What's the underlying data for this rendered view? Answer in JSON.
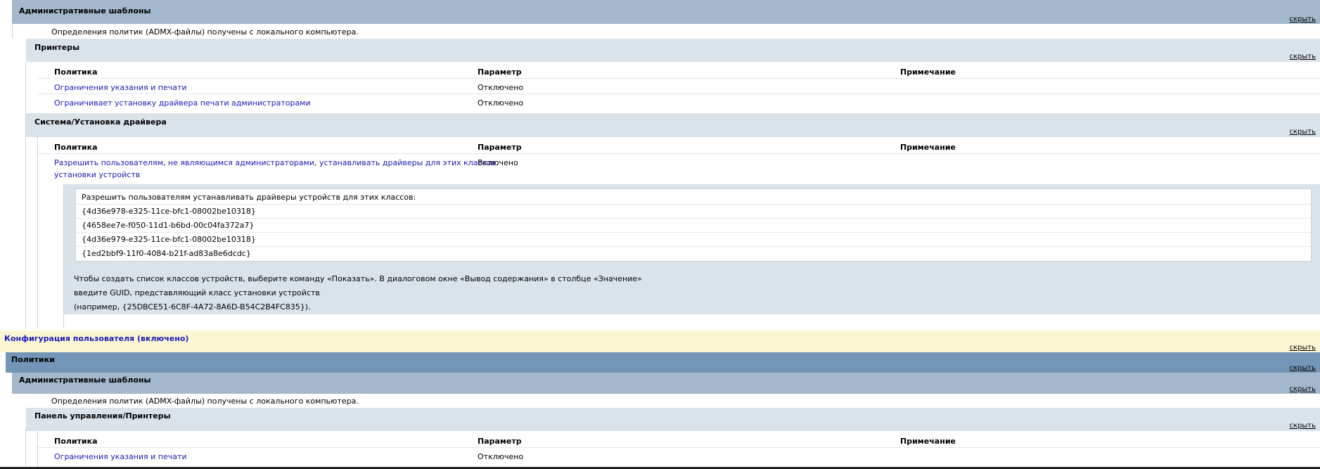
{
  "computer": {
    "admin_templates": {
      "title": "Административные шаблоны",
      "hide": "скрыть",
      "note": "Определения политик (ADMX-файлы) получены с локального компьютера."
    },
    "printers": {
      "title": "Принтеры",
      "hide": "скрыть",
      "columns": [
        "Политика",
        "Параметр",
        "Примечание"
      ],
      "rows": [
        {
          "policy": "Ограничения указания и печати",
          "setting": "Отключено"
        },
        {
          "policy": "Ограничивает установку драйвера печати администраторами",
          "setting": "Отключено"
        }
      ]
    },
    "driver_install": {
      "title": "Система/Установка драйвера",
      "hide": "скрыть",
      "columns": [
        "Политика",
        "Параметр",
        "Примечание"
      ],
      "row": {
        "policy_line1": "Разрешить пользователям, не являющимся администраторами, устанавливать драйверы для этих классов",
        "policy_line2": "установки устройств",
        "setting": "Включено"
      },
      "detail": {
        "header": "Разрешить пользователям устанавливать драйверы устройств для этих классов:",
        "guids": [
          "{4d36e978-e325-11ce-bfc1-08002be10318}",
          "{4658ee7e-f050-11d1-b6bd-00c04fa372a7}",
          "{4d36e979-e325-11ce-bfc1-08002be10318}",
          "{1ed2bbf9-11f0-4084-b21f-ad83a8e6dcdc}"
        ],
        "help1": "Чтобы создать список классов устройств, выберите команду «Показать». В диалоговом окне «Вывод содержания» в столбце «Значение»",
        "help2": "введите GUID, представляющий класс установки устройств",
        "help3": "(например, {25DBCE51-6C8F-4A72-8A6D-B54C2B4FC835})."
      }
    }
  },
  "user_config": {
    "title": "Конфигурация пользователя (включено)",
    "hide": "скрыть",
    "policies": {
      "title": "Политики",
      "hide": "скрыть"
    },
    "admin_templates": {
      "title": "Административные шаблоны",
      "hide": "скрыть",
      "note": "Определения политик (ADMX-файлы) получены с локального компьютера."
    },
    "cp_printers": {
      "title": "Панель управления/Принтеры",
      "hide": "скрыть",
      "columns": [
        "Политика",
        "Параметр",
        "Примечание"
      ],
      "rows": [
        {
          "policy": "Ограничения указания и печати",
          "setting": "Отключено"
        }
      ]
    }
  },
  "colors": {
    "band_dark": "#7396b8",
    "band_mid": "#a3b8cc",
    "band_light": "#dae3ea",
    "band_yellow": "#fcf6d5",
    "link": "#1a1ab8"
  }
}
